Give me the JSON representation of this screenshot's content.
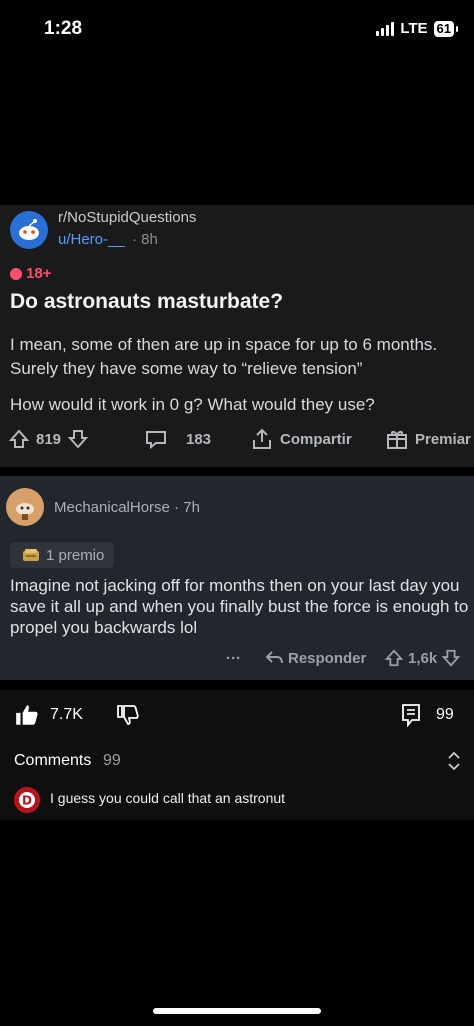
{
  "status_bar": {
    "time": "1:28",
    "network": "LTE",
    "battery": "61"
  },
  "post": {
    "subreddit": "r/NoStupidQuestions",
    "author": "u/Hero-__",
    "time": "· 8h",
    "nsfw_label": "18+",
    "title": "Do astronauts masturbate?",
    "body_1": "I mean, some of then are up in space for up to 6 months. Surely they have some way to “relieve tension”",
    "body_2": "How would it work in 0 g? What would they use?",
    "votes": "819",
    "comments": "183",
    "share_label": "Compartir",
    "award_label": "Premiar"
  },
  "comment": {
    "author": "MechanicalHorse",
    "time": "· 7h",
    "award": "1 premio",
    "body": "Imagine not jacking off for months then on your last day you save it all up and when you finally bust the force is enough to propel you backwards lol",
    "more": "···",
    "reply_label": "Responder",
    "votes": "1,6k"
  },
  "video_footer": {
    "likes": "7.7K",
    "comments_right": "99",
    "comments_label": "Comments",
    "comments_count": "99",
    "top_comment": "I guess you could call that an astronut",
    "top_comment_avatar_letter": "D"
  },
  "colors": {
    "background": "#000000",
    "post_bg": "#1a1a1b",
    "comment_bg": "#22262d",
    "link": "#4f9fff",
    "nsfw": "#ff4f6d"
  }
}
